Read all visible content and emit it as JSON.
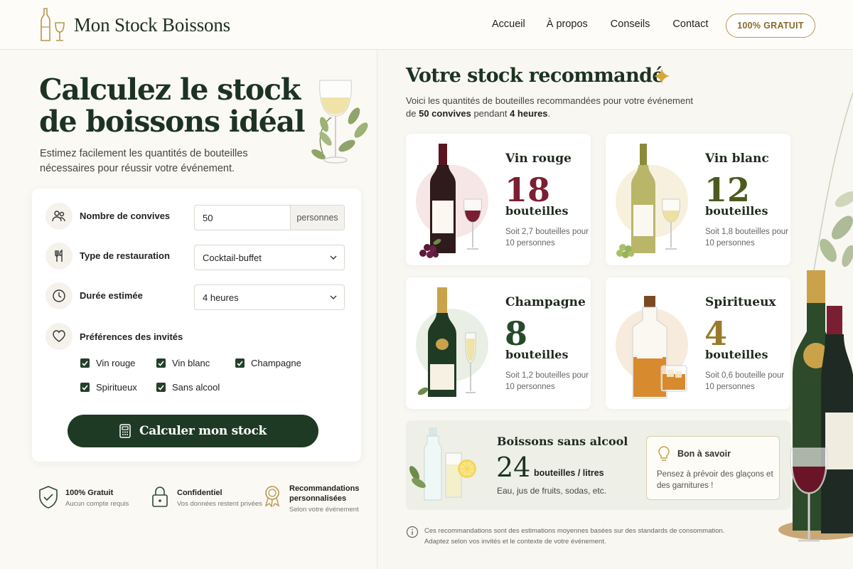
{
  "header": {
    "brand": "Mon Stock Boissons",
    "nav": [
      "Accueil",
      "À propos",
      "Conseils",
      "Contact"
    ],
    "cta": "100% GRATUIT"
  },
  "hero": {
    "title_line1": "Calculez le stock",
    "title_line2": "de boissons idéal",
    "subtitle": "Estimez facilement les quantités de bouteilles nécessaires pour réussir votre événement."
  },
  "form": {
    "guests": {
      "label": "Nombre de convives",
      "value": "50",
      "unit": "personnes"
    },
    "catering": {
      "label": "Type de restauration",
      "value": "Cocktail-buffet"
    },
    "duration": {
      "label": "Durée estimée",
      "value": "4 heures"
    },
    "preferences": {
      "label": "Préférences des invités",
      "options": [
        "Vin rouge",
        "Vin blanc",
        "Champagne",
        "Spiritueux",
        "Sans alcool"
      ]
    },
    "submit": "Calculer mon stock"
  },
  "badges": [
    {
      "title": "100% Gratuit",
      "sub": "Aucun compte requis"
    },
    {
      "title": "Confidentiel",
      "sub": "Vos données restent privées"
    },
    {
      "title": "Recommandations personnalisées",
      "sub": "Selon votre événement"
    }
  ],
  "results": {
    "title": "Votre stock recommandé",
    "intro_a": "Voici les quantités de bouteilles recommandées pour votre événement",
    "intro_b": "de",
    "intro_guests": "50 convives",
    "intro_c": "pendant",
    "intro_duration": "4 heures",
    "intro_end": ".",
    "cards": [
      {
        "name": "Vin rouge",
        "qty": "18",
        "unit": "bouteilles",
        "note": "Soit 2,7 bouteilles pour 10 personnes",
        "color": "#7a1f33"
      },
      {
        "name": "Vin blanc",
        "qty": "12",
        "unit": "bouteilles",
        "note": "Soit 1,8 bouteilles pour 10 personnes",
        "color": "#4d5a1f"
      },
      {
        "name": "Champagne",
        "qty": "8",
        "unit": "bouteilles",
        "note": "Soit 1,2 bouteilles pour 10 personnes",
        "color": "#264a2a"
      },
      {
        "name": "Spiritueux",
        "qty": "4",
        "unit": "bouteilles",
        "note": "Soit 0,6 bouteille pour 10 personnes",
        "color": "#9a7a2a"
      }
    ],
    "soft": {
      "name": "Boissons sans alcool",
      "qty": "24",
      "unit": "bouteilles / litres",
      "note": "Eau, jus de fruits, sodas, etc."
    },
    "tip": {
      "title": "Bon à savoir",
      "text": "Pensez à prévoir des glaçons et des garnitures !"
    },
    "disclaimer": "Ces recommandations sont des estimations moyennes basées sur des standards de consommation. Adaptez selon vos invités et le contexte de votre événement."
  }
}
